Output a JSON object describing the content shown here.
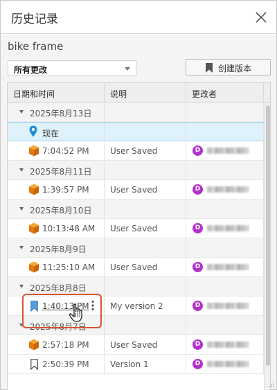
{
  "dialog": {
    "title": "历史记录"
  },
  "model": {
    "name": "bike frame"
  },
  "filter": {
    "selected": "所有更改"
  },
  "toolbar": {
    "create_version_label": "创建版本"
  },
  "table": {
    "columns": [
      "日期和时间",
      "说明",
      "更改者"
    ],
    "rows": [
      {
        "kind": "group",
        "date": "2025年8月13日"
      },
      {
        "kind": "current",
        "label": "现在",
        "icon": "location-pin-icon"
      },
      {
        "kind": "version",
        "time": "7:04:52 PM",
        "description": "User Saved",
        "icon": "cube-icon",
        "avatar": "D"
      },
      {
        "kind": "group",
        "date": "2025年8月11日"
      },
      {
        "kind": "version",
        "time": "1:39:57 PM",
        "description": "User Saved",
        "icon": "cube-icon",
        "avatar": "D"
      },
      {
        "kind": "group",
        "date": "2025年8月10日"
      },
      {
        "kind": "version",
        "time": "10:13:48 AM",
        "description": "User Saved",
        "icon": "cube-icon",
        "avatar": "D"
      },
      {
        "kind": "group",
        "date": "2025年8月9日"
      },
      {
        "kind": "version",
        "time": "11:25:10 AM",
        "description": "User Saved",
        "icon": "cube-icon",
        "avatar": "D"
      },
      {
        "kind": "group",
        "date": "2025年8月8日"
      },
      {
        "kind": "version",
        "time": "1:40:13 PM",
        "description": "My version 2",
        "icon": "bookmark-filled-icon",
        "avatar": "D"
      },
      {
        "kind": "group",
        "date": "2025年8月7日"
      },
      {
        "kind": "version",
        "time": "2:57:18 PM",
        "description": "User Saved",
        "icon": "cube-icon",
        "avatar": "D"
      },
      {
        "kind": "version",
        "time": "2:50:39 PM",
        "description": "Version 1",
        "icon": "bookmark-outline-icon",
        "avatar": "D"
      }
    ]
  },
  "colors": {
    "accent": "#1f8fd0",
    "cube_orange": "#f08a17",
    "avatar_purple": "#b233c9",
    "highlight_red": "#d9532c",
    "current_row_bg": "#dff1fa"
  }
}
